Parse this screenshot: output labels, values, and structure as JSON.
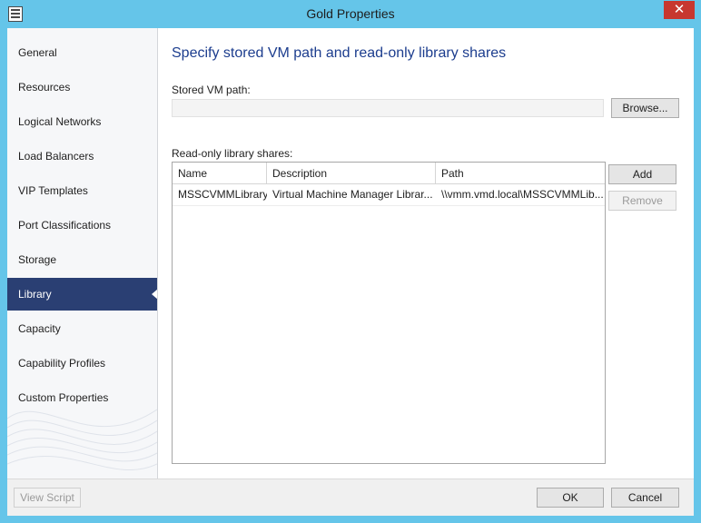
{
  "window": {
    "title": "Gold Properties",
    "close_glyph": "✕"
  },
  "colors": {
    "frame": "#65c5e9",
    "nav_selected": "#2a3f73",
    "header_text": "#1c3d8e",
    "close_button": "#c7372f"
  },
  "sidebar": {
    "items": [
      {
        "label": "General"
      },
      {
        "label": "Resources"
      },
      {
        "label": "Logical Networks"
      },
      {
        "label": "Load Balancers"
      },
      {
        "label": "VIP Templates"
      },
      {
        "label": "Port Classifications"
      },
      {
        "label": "Storage"
      },
      {
        "label": "Library",
        "selected": true
      },
      {
        "label": "Capacity"
      },
      {
        "label": "Capability Profiles"
      },
      {
        "label": "Custom Properties"
      }
    ]
  },
  "main": {
    "header": "Specify stored VM path and read-only library shares",
    "stored_vm_path": {
      "label": "Stored VM path:",
      "value": "",
      "browse_label": "Browse..."
    },
    "shares": {
      "label": "Read-only library shares:",
      "columns": [
        "Name",
        "Description",
        "Path"
      ],
      "rows": [
        [
          "MSSCVMMLibrary",
          "Virtual Machine Manager Librar...",
          "\\\\vmm.vmd.local\\MSSCVMMLib..."
        ]
      ],
      "add_label": "Add",
      "remove_label": "Remove"
    }
  },
  "footer": {
    "view_script_label": "View Script",
    "ok_label": "OK",
    "cancel_label": "Cancel"
  },
  "icons": {
    "app": "app-icon",
    "close": "close-icon"
  }
}
